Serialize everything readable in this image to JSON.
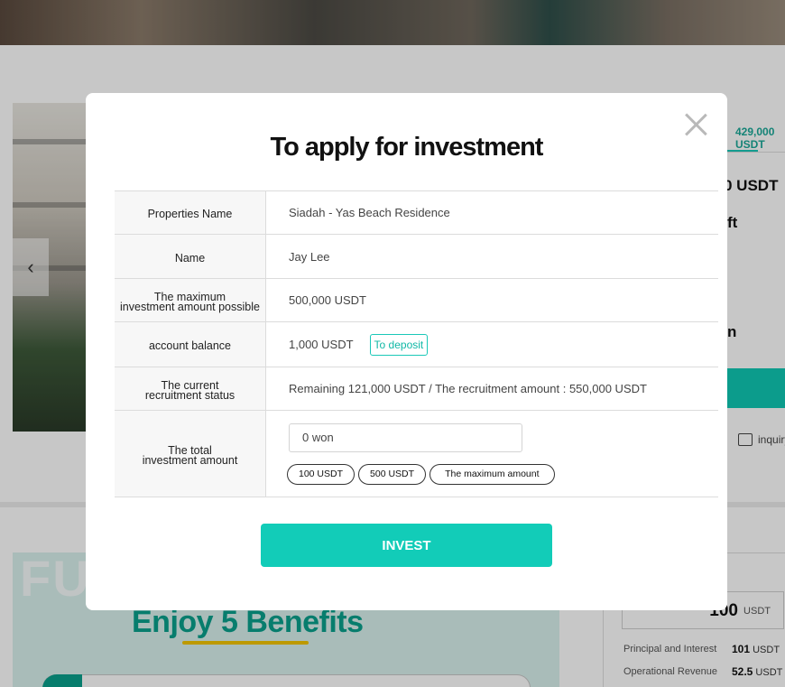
{
  "background": {
    "tab_amount": "429,000 USDT",
    "amount_partial": "0 USDT",
    "area_partial": "ft",
    "text_partial": "n",
    "inquiry_label": "inquiry",
    "banner_watermark": "FU",
    "banner_title": "Enjoy 5 Benefits",
    "side_amount": "100",
    "side_unit": "USDT",
    "side_rows": [
      {
        "label": "Principal and Interest",
        "value": "101",
        "unit": "USDT"
      },
      {
        "label": "Operational Revenue",
        "value": "52.5",
        "unit": "USDT"
      }
    ]
  },
  "modal": {
    "title": "To apply for investment",
    "rows": [
      {
        "label": "Properties Name",
        "value": "Siadah - Yas Beach Residence"
      },
      {
        "label": "Name",
        "value": "Jay Lee"
      },
      {
        "label_line1": "The maximum",
        "label_line2": "investment amount possible",
        "value": "500,000 USDT"
      },
      {
        "label": "account balance",
        "value": "1,000 USDT",
        "button": "To deposit"
      },
      {
        "label_line1": "The current",
        "label_line2": "recruitment status",
        "value": "Remaining 121,000 USDT / The recruitment amount : 550,000 USDT"
      },
      {
        "label_line1": "The total",
        "label_line2": "investment amount"
      }
    ],
    "amount_input_value": "0 won",
    "chips": [
      "100 USDT",
      "500 USDT",
      "The maximum amount"
    ],
    "invest_label": "INVEST"
  }
}
